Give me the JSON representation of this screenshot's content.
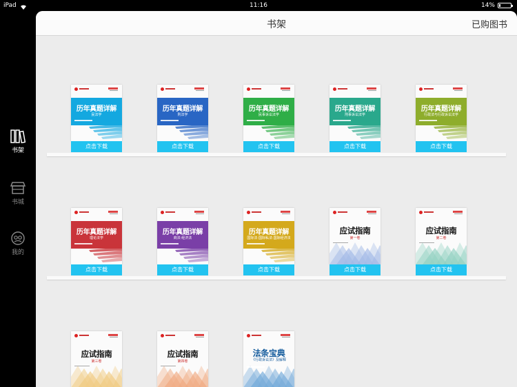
{
  "status_bar": {
    "device": "iPad",
    "time": "11:16",
    "battery": "14%",
    "battery_level": 0.14
  },
  "sidebar": {
    "items": [
      {
        "label": "书架",
        "icon": "bookshelf-icon",
        "active": true
      },
      {
        "label": "书城",
        "icon": "store-icon",
        "active": false
      },
      {
        "label": "我的",
        "icon": "profile-icon",
        "active": false
      }
    ]
  },
  "navbar": {
    "title": "书架",
    "action": "已购图书"
  },
  "download_label": "点击下载",
  "books": [
    {
      "title": "历年真题详解",
      "subtitle": "民法学",
      "color": "#14a8e0",
      "style": "zt"
    },
    {
      "title": "历年真题详解",
      "subtitle": "刑法学",
      "color": "#2966c4",
      "style": "zt"
    },
    {
      "title": "历年真题详解",
      "subtitle": "民事诉讼法学",
      "color": "#2fae47",
      "style": "zt"
    },
    {
      "title": "历年真题详解",
      "subtitle": "刑事诉讼法学",
      "color": "#2aa88c",
      "style": "zt"
    },
    {
      "title": "历年真题详解",
      "subtitle": "行政法与行政诉讼法学",
      "color": "#8ead2c",
      "style": "zt"
    },
    {
      "title": "历年真题详解",
      "subtitle": "理论法学",
      "color": "#c9343a",
      "style": "zt"
    },
    {
      "title": "历年真题详解",
      "subtitle": "商法·经济法",
      "color": "#7a3fa7",
      "style": "zt"
    },
    {
      "title": "历年真题详解",
      "subtitle": "国际法·国际私法·国际经济法",
      "color": "#d4a91c",
      "style": "zt"
    },
    {
      "title": "应试指南",
      "subtitle": "第一卷",
      "color": "#9fb7e6",
      "style": "guide"
    },
    {
      "title": "应试指南",
      "subtitle": "第二卷",
      "color": "#8fd0c0",
      "style": "guide"
    },
    {
      "title": "应试指南",
      "subtitle": "第三卷",
      "color": "#f0c97e",
      "style": "guide"
    },
    {
      "title": "应试指南",
      "subtitle": "第四卷",
      "color": "#f0a87e",
      "style": "guide"
    },
    {
      "title": "法条宝典",
      "subtitle": "《行政诉讼法》及解释",
      "color": "#6fa7d8",
      "style": "fatiao"
    }
  ]
}
